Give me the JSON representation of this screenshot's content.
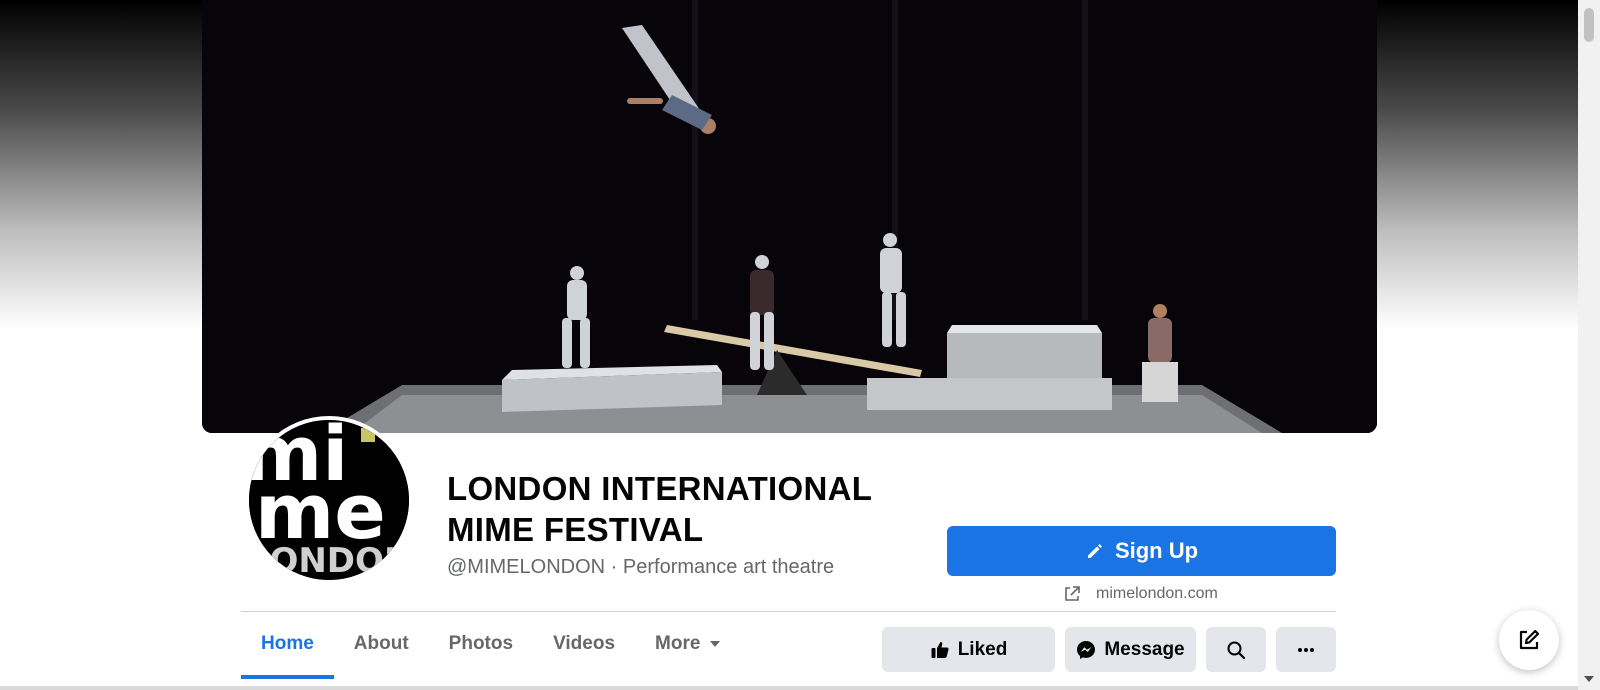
{
  "page": {
    "name_line1": "LONDON INTERNATIONAL",
    "name_line2": "MIME FESTIVAL",
    "handle": "@MIMELONDON",
    "separator": "·",
    "category": "Performance art theatre",
    "avatar_text": "mime LONDON"
  },
  "cta": {
    "signup_label": "Sign Up",
    "icon": "pencil-icon"
  },
  "website": {
    "url": "mimelondon.com",
    "icon": "external-link-icon"
  },
  "tabs": [
    {
      "label": "Home",
      "active": true
    },
    {
      "label": "About",
      "active": false
    },
    {
      "label": "Photos",
      "active": false
    },
    {
      "label": "Videos",
      "active": false
    },
    {
      "label": "More",
      "active": false
    }
  ],
  "actions": {
    "liked_label": "Liked",
    "message_label": "Message",
    "search_icon": "search-icon",
    "more_icon": "ellipsis-icon"
  },
  "colors": {
    "accent": "#1b74e4",
    "button_gray": "#e4e6eb",
    "secondary_text": "#65676b"
  }
}
